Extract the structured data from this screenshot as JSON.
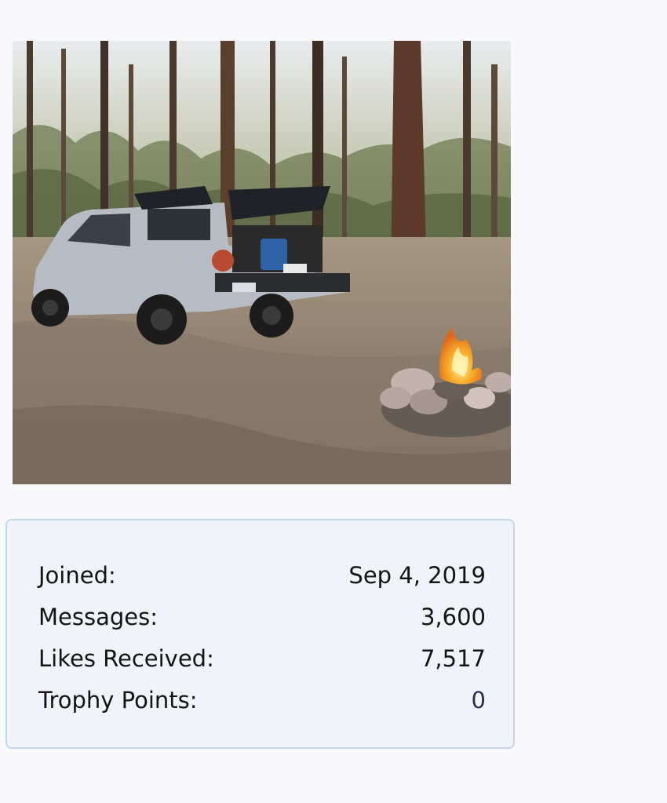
{
  "avatar": {
    "alt": "Member avatar"
  },
  "stats": [
    {
      "label": "Joined:",
      "value": "Sep 4, 2019"
    },
    {
      "label": "Messages:",
      "value": "3,600"
    },
    {
      "label": "Likes Received:",
      "value": "7,517"
    },
    {
      "label": "Trophy Points:",
      "value": "0"
    }
  ],
  "colors": {
    "page_background": "#f9f9fb",
    "panel_background": "#f0f4f8",
    "panel_border": "#c3d7e8",
    "text": "#141414",
    "trophy_value": "#2b2d50"
  }
}
